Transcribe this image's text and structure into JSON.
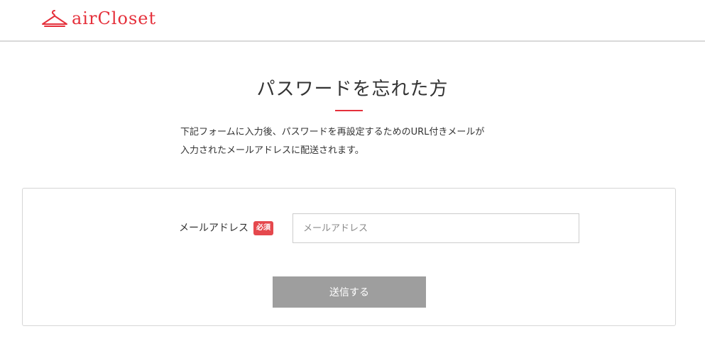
{
  "header": {
    "logo_text": "airCloset",
    "logo_icon": "hanger-icon",
    "brand_color": "#e5303b"
  },
  "main": {
    "title": "パスワードを忘れた方",
    "description_line1": "下記フォームに入力後、パスワードを再設定するためのURL付きメールが",
    "description_line2": "入力されたメールアドレスに配送されます。"
  },
  "form": {
    "email_label": "メールアドレス",
    "required_badge": "必須",
    "email_value": "",
    "email_placeholder": "メールアドレス",
    "submit_label": "送信する"
  },
  "colors": {
    "accent": "#e5303b",
    "badge": "#e5484d",
    "button_disabled": "#9e9e9e",
    "border": "#d6d6d6"
  }
}
